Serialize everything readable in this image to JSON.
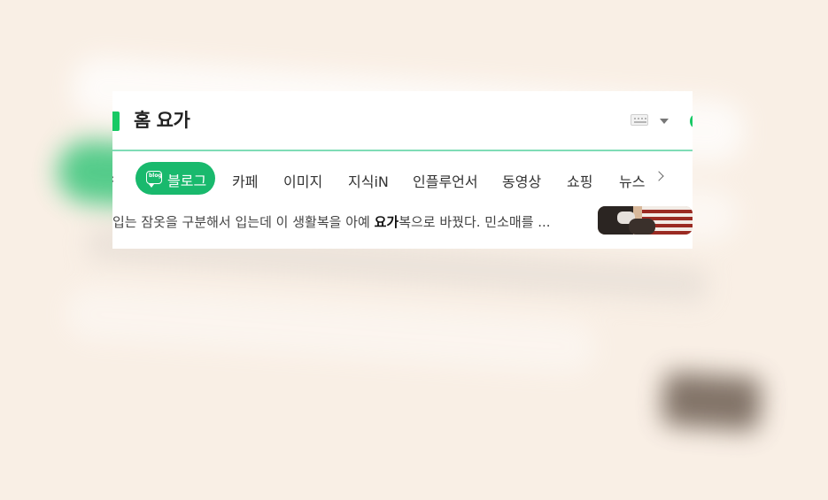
{
  "search": {
    "query": "홈 요가"
  },
  "tabs": [
    {
      "label": "블로그",
      "active": true
    },
    {
      "label": "카페"
    },
    {
      "label": "이미지"
    },
    {
      "label": "지식iN"
    },
    {
      "label": "인플루언서"
    },
    {
      "label": "동영상"
    },
    {
      "label": "쇼핑"
    },
    {
      "label": "뉴스"
    }
  ],
  "blog_icon_text": "blog",
  "result": {
    "snippet_before": "입는 잠옷을 구분해서 입는데 이 생활복을 아예 ",
    "snippet_highlight": "요가",
    "snippet_after": "복으로 바꿨다. 민소매를 ..."
  },
  "colors": {
    "accent": "#19b96d",
    "underline": "#7fdcb6",
    "background": "#f9efe5"
  },
  "icons": [
    "keyboard-icon",
    "dropdown-caret-icon",
    "blog-icon",
    "chevron-left-icon",
    "chevron-right-icon"
  ]
}
